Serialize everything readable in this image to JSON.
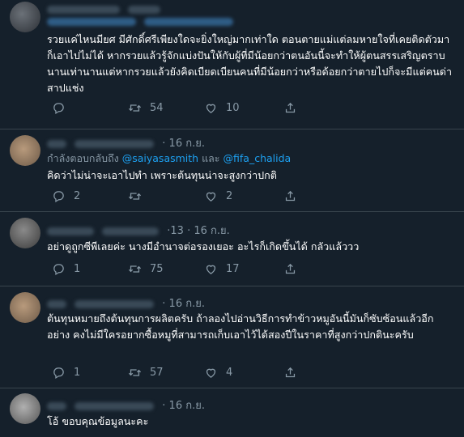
{
  "colors": {
    "background": "#15202b",
    "text": "#ffffff",
    "muted": "#8899a6",
    "link": "#1da1f2",
    "divider": "#38444d"
  },
  "tweets": [
    {
      "body": "รวยแค่ไหนมียศ มีศักดิ์ศรีเพียงใดจะยิ่งใหญ่มากเท่าใด ตอนตายแม่แต่ลมหายใจที่เคยติดตัวมา ก็เอาไปไม่ได้ หากรวยแล้วรู้จักแบ่งปันให้กับผู้ที่มีน้อยกว่าตนอันนี้จะทำให้ผู้ตนสรรเสริญตราบนานเท่านานแต่หากรวยแล้วยังคิดเบียดเบียนคนที่มีน้อยกว่าหรือด้อยกว่าตายไปก็จะมีแต่คนด่าสาปแช่ง",
      "reply_count": "",
      "retweet_count": "54",
      "like_count": "10"
    },
    {
      "time": "· 16 ก.ย.",
      "reply_prefix": "กำลังตอบกลับถึง",
      "reply_mention_1": "@saiyasasmith",
      "reply_and": "และ",
      "reply_mention_2": "@fifa_chalida",
      "body": "คิดว่าไม่น่าจะเอาไปทำ เพราะต้นทุนน่าจะสูงกว่าปกติ",
      "reply_count": "2",
      "retweet_count": "",
      "like_count": "2"
    },
    {
      "handle_tail": "·13",
      "time": "· 16 ก.ย.",
      "body": "อย่าดูถูกซีพีเลยค่ะ นางมีอำนาจต่อรองเยอะ อะไรก็เกิดขึ้นได้ กลัวแล้ววว",
      "reply_count": "1",
      "retweet_count": "75",
      "like_count": "17"
    },
    {
      "time": "· 16 ก.ย.",
      "body": "ต้นทุนหมายถึงต้นทุนการผลิตครับ ถ้าลองไปอ่านวิธีการทำข้าวหมูอันนี้มันก็ซับซ้อนแล้วอีกอย่าง คงไม่มีใครอยากซื้อหมูที่สามารถเก็บเอาไว้ได้สองปีในราคาที่สูงกว่าปกตินะครับ",
      "reply_count": "1",
      "retweet_count": "57",
      "like_count": "4"
    },
    {
      "time": "· 16 ก.ย.",
      "body": "โอ้ ขอบคุณข้อมูลนะคะ"
    }
  ]
}
